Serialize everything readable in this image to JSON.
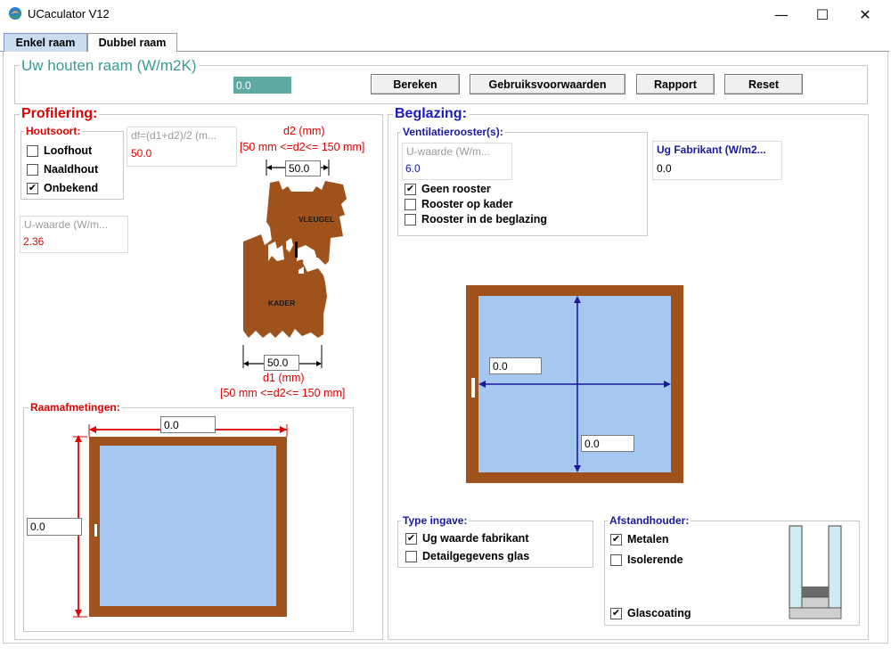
{
  "window": {
    "title": "UCaculator V12",
    "minimize": "—",
    "maximize": "☐",
    "close": "✕"
  },
  "tabs": [
    {
      "label": "Enkel raam"
    },
    {
      "label": "Dubbel raam"
    }
  ],
  "header": {
    "title": "Uw houten raam (W/m2K)",
    "result_value": "0.0",
    "buttons": {
      "bereken": "Bereken",
      "gebruiksvoorwaarden": "Gebruiksvoorwaarden",
      "rapport": "Rapport",
      "reset": "Reset"
    }
  },
  "profilering": {
    "title": "Profilering:",
    "houtsoort": {
      "legend": "Houtsoort:",
      "options": [
        {
          "label": "Loofhout",
          "checked": false
        },
        {
          "label": "Naaldhout",
          "checked": false
        },
        {
          "label": "Onbekend",
          "checked": true
        }
      ]
    },
    "df": {
      "label": "df=(d1+d2)/2 (m...",
      "value": "50.0"
    },
    "uwaarde": {
      "label": "U-waarde (W/m...",
      "value": "2.36"
    },
    "d2": {
      "label": "d2 (mm)",
      "range": "[50 mm <=d2<= 150 mm]",
      "value": "50.0"
    },
    "d1": {
      "label": "d1 (mm)",
      "range": "[50 mm <=d2<= 150 mm]",
      "value": "50.0"
    },
    "vleugel_label": "VLEUGEL",
    "kader_label": "KADER"
  },
  "raamafmetingen": {
    "legend": "Raamafmetingen:",
    "width": "0.0",
    "height": "0.0"
  },
  "beglazing": {
    "title": "Beglazing:",
    "ventilatie": {
      "legend": "Ventilatierooster(s):",
      "uwaarde_label": "U-waarde (W/m...",
      "uwaarde_value": "6.0",
      "options": [
        {
          "label": "Geen rooster",
          "checked": true
        },
        {
          "label": "Rooster op kader",
          "checked": false
        },
        {
          "label": "Rooster in de beglazing",
          "checked": false
        }
      ]
    },
    "ug_fabrikant": {
      "label": "Ug Fabrikant (W/m2...",
      "value": "0.0"
    },
    "glass_width": "0.0",
    "glass_height": "0.0",
    "type_ingave": {
      "legend": "Type ingave:",
      "options": [
        {
          "label": "Ug waarde fabrikant",
          "checked": true
        },
        {
          "label": "Detailgegevens glas",
          "checked": false
        }
      ]
    },
    "afstandhouder": {
      "legend": "Afstandhouder:",
      "options": [
        {
          "label": "Metalen",
          "checked": true
        },
        {
          "label": "Isolerende",
          "checked": false
        }
      ],
      "glascoating": {
        "label": "Glascoating",
        "checked": true
      }
    }
  },
  "colors": {
    "wood": "#a0521d",
    "glass": "#a6c8f0",
    "accent_red": "#e00000",
    "accent_blue": "#1a1ac0",
    "teal": "#3a9a96",
    "tab_active": "#c9dcf0"
  }
}
